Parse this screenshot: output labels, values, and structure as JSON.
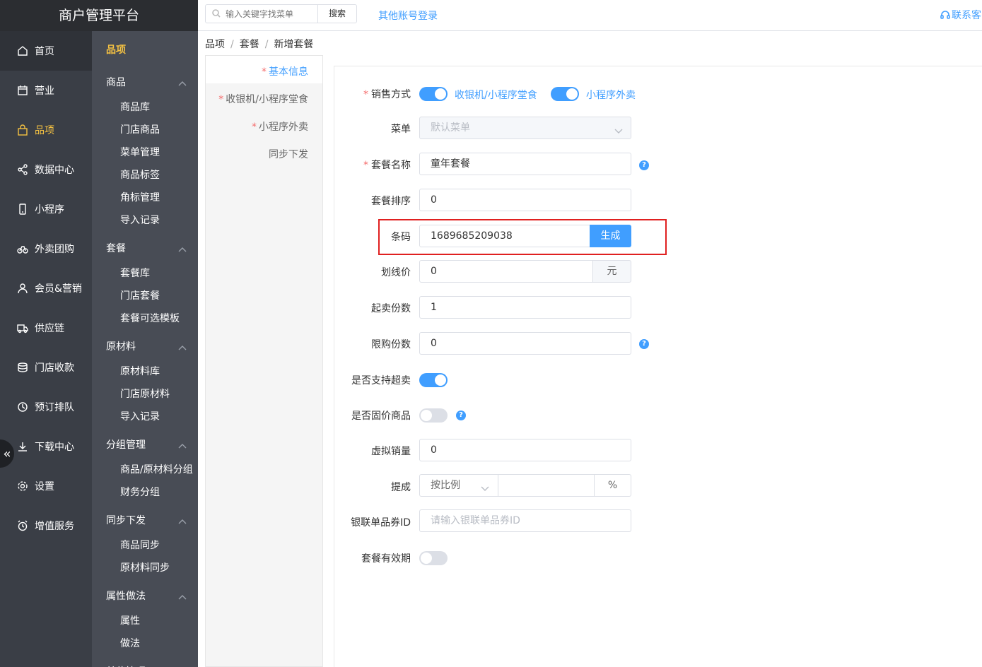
{
  "brand": "商户管理平台",
  "nav": [
    {
      "label": "首页",
      "icon": "home-icon"
    },
    {
      "label": "营业",
      "icon": "calendar-icon"
    },
    {
      "label": "品项",
      "icon": "bag-icon",
      "active": true
    },
    {
      "label": "数据中心",
      "icon": "share-icon"
    },
    {
      "label": "小程序",
      "icon": "phone-icon"
    },
    {
      "label": "外卖团购",
      "icon": "bike-icon"
    },
    {
      "label": "会员&营销",
      "icon": "user-icon"
    },
    {
      "label": "供应链",
      "icon": "truck-icon"
    },
    {
      "label": "门店收款",
      "icon": "coins-icon"
    },
    {
      "label": "预订排队",
      "icon": "clock-icon"
    },
    {
      "label": "下载中心",
      "icon": "download-icon"
    },
    {
      "label": "设置",
      "icon": "gear-icon"
    },
    {
      "label": "增值服务",
      "icon": "alarm-icon"
    }
  ],
  "collapse_glyph": "«",
  "sub": {
    "title": "品项",
    "groups": [
      {
        "name": "商品",
        "items": [
          "商品库",
          "门店商品",
          "菜单管理",
          "商品标签",
          "角标管理",
          "导入记录"
        ]
      },
      {
        "name": "套餐",
        "items": [
          "套餐库",
          "门店套餐",
          "套餐可选模板"
        ]
      },
      {
        "name": "原材料",
        "items": [
          "原材料库",
          "门店原材料",
          "导入记录"
        ]
      },
      {
        "name": "分组管理",
        "items": [
          "商品/原材料分组",
          "财务分组"
        ]
      },
      {
        "name": "同步下发",
        "items": [
          "商品同步",
          "原材料同步"
        ]
      },
      {
        "name": "属性做法",
        "items": [
          "属性",
          "做法"
        ]
      },
      {
        "name": "单位管理",
        "items": []
      }
    ]
  },
  "topbar": {
    "search_placeholder": "输入关键字找菜单",
    "search_button": "搜索",
    "other_login": "其他账号登录",
    "contact": "联系客"
  },
  "breadcrumb": [
    "品项",
    "套餐",
    "新增套餐"
  ],
  "breadcrumb_sep": "/",
  "steps": [
    {
      "label": "基本信息",
      "required": true,
      "active": true
    },
    {
      "label": "收银机/小程序堂食",
      "required": true
    },
    {
      "label": "小程序外卖",
      "required": true
    },
    {
      "label": "同步下发",
      "required": false
    }
  ],
  "required_mark": "*",
  "form": {
    "sale_mode": {
      "label": "销售方式",
      "options": [
        {
          "label": "收银机/小程序堂食",
          "on": true
        },
        {
          "label": "小程序外卖",
          "on": true
        }
      ]
    },
    "menu": {
      "label": "菜单",
      "value": "默认菜单"
    },
    "name": {
      "label": "套餐名称",
      "value": "童年套餐"
    },
    "sort": {
      "label": "套餐排序",
      "value": "0"
    },
    "barcode": {
      "label": "条码",
      "value": "1689685209038",
      "button": "生成"
    },
    "strike_price": {
      "label": "划线价",
      "value": "0",
      "unit": "元"
    },
    "min_qty": {
      "label": "起卖份数",
      "value": "1"
    },
    "limit_qty": {
      "label": "限购份数",
      "value": "0"
    },
    "oversell": {
      "label": "是否支持超卖",
      "on": true
    },
    "fixed_price": {
      "label": "是否固价商品",
      "on": false
    },
    "virtual_sales": {
      "label": "虚拟销量",
      "value": "0"
    },
    "commission": {
      "label": "提成",
      "mode": "按比例",
      "value": "",
      "unit": "%"
    },
    "unionpay": {
      "label": "银联单品券ID",
      "placeholder": "请输入银联单品券ID"
    },
    "validity": {
      "label": "套餐有效期",
      "on": false
    }
  },
  "help_glyph": "?"
}
